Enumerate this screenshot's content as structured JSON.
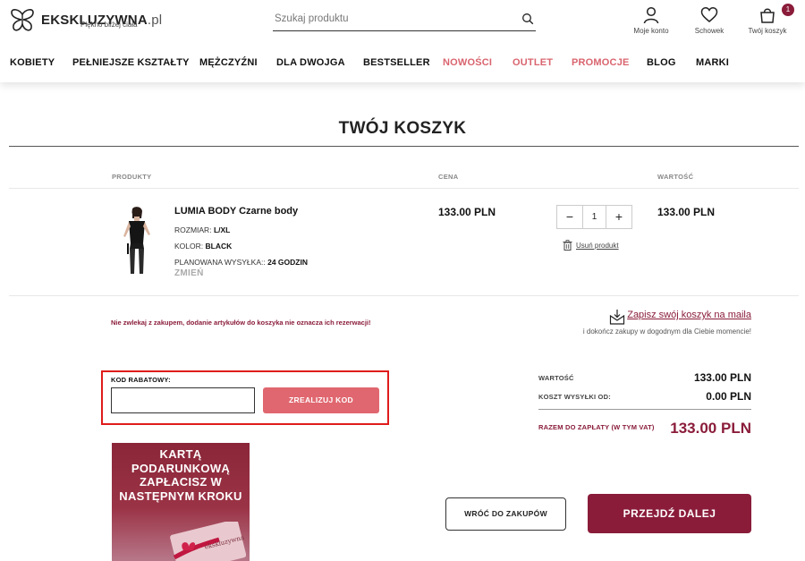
{
  "header": {
    "logo_name": "EKSKLUZYWNA",
    "logo_tld": ".pl",
    "logo_tagline": "Piękno bliżej ciała",
    "search_placeholder": "Szukaj produktu",
    "account_label": "Moje konto",
    "wishlist_label": "Schowek",
    "cart_label": "Twój koszyk",
    "cart_count": "1"
  },
  "nav": {
    "items": [
      {
        "label": "KOBIETY"
      },
      {
        "label": "PEŁNIEJSZE KSZTAŁTY"
      },
      {
        "label": "MĘŻCZYŹNI"
      },
      {
        "label": "DLA DWOJGA"
      },
      {
        "label": "BESTSELLER"
      },
      {
        "label": "NOWOŚCI"
      },
      {
        "label": "OUTLET"
      },
      {
        "label": "PROMOCJE"
      },
      {
        "label": "BLOG"
      },
      {
        "label": "MARKI"
      }
    ],
    "highlight_color": "#d9646e"
  },
  "cart": {
    "title": "TWÓJ KOSZYK",
    "columns": {
      "products": "PRODUKTY",
      "price": "CENA",
      "value": "WARTOŚĆ"
    },
    "item": {
      "name": "LUMIA BODY Czarne body",
      "size_label": "ROZMIAR:",
      "size_value": "L/XL",
      "color_label": "KOLOR:",
      "color_value": "BLACK",
      "shipping_label": "PLANOWANA WYSYŁKA::",
      "shipping_value": "24 GODZIN",
      "change_label": "ZMIEŃ",
      "price": "133.00 PLN",
      "quantity": "1",
      "minus": "−",
      "plus": "+",
      "remove_label": "Usuń produkt",
      "value": "133.00 PLN"
    },
    "warning": "Nie zwlekaj z zakupem, dodanie artykułów do koszyka nie oznacza ich rezerwacji!",
    "save_link": "Zapisz swój koszyk na maila",
    "save_sub": "i dokończ zakupy w dogodnym dla Ciebie momencie!"
  },
  "coupon": {
    "label": "KOD RABATOWY:",
    "input_value": "",
    "button": "ZREALIZUJ KOD"
  },
  "summary": {
    "value_label": "WARTOŚĆ",
    "value": "133.00 PLN",
    "shipping_label": "KOSZT WYSYŁKI OD:",
    "shipping": "0.00 PLN",
    "total_label": "RAZEM DO ZAPŁATY (W TYM VAT)",
    "total": "133.00 PLN"
  },
  "banner": {
    "text": "KARTĄ PODARUNKOWĄ ZAPŁACISZ W NASTĘPNYM KROKU",
    "card_logo": "ekskluzywna"
  },
  "actions": {
    "back": "WRÓĆ DO ZAKUPÓW",
    "next": "PRZEJDŹ DALEJ"
  },
  "colors": {
    "brand": "#8a1c3a",
    "coupon_button": "#e0676f",
    "highlight_box": "#e01b1b"
  }
}
